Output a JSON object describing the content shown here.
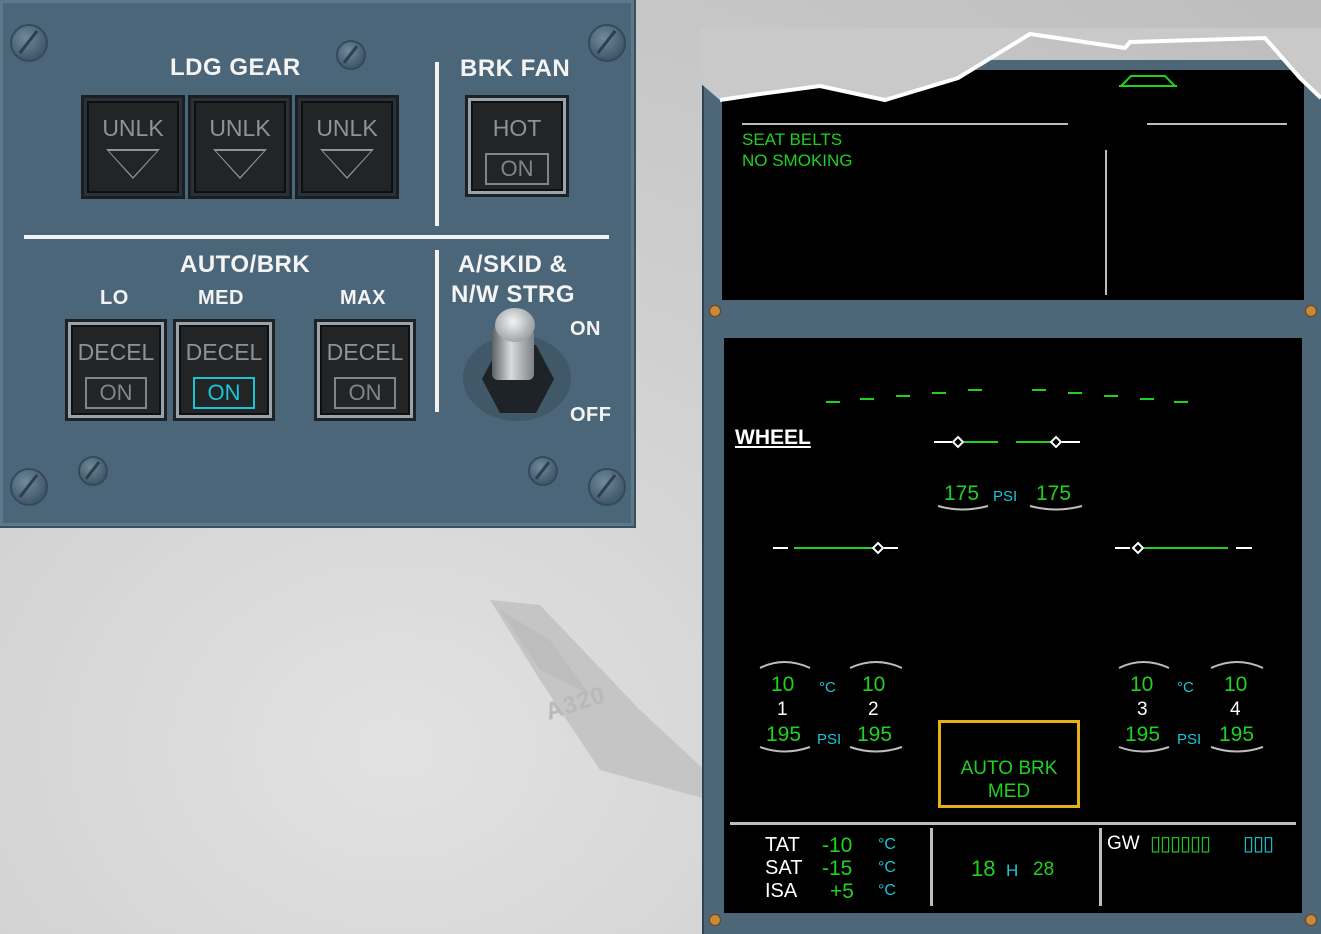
{
  "background": {
    "tail_marking": "A320"
  },
  "overhead_panel": {
    "ldg_gear": {
      "title": "LDG GEAR",
      "indicators": [
        {
          "label": "UNLK",
          "state": "unlit"
        },
        {
          "label": "UNLK",
          "state": "unlit"
        },
        {
          "label": "UNLK",
          "state": "unlit"
        }
      ]
    },
    "brk_fan": {
      "title": "BRK FAN",
      "top_label": "HOT",
      "on_label": "ON",
      "on_lit": false
    },
    "auto_brk": {
      "title": "AUTO/BRK",
      "buttons": [
        {
          "mode": "LO",
          "label": "DECEL",
          "on_label": "ON",
          "on_lit": false
        },
        {
          "mode": "MED",
          "label": "DECEL",
          "on_label": "ON",
          "on_lit": true
        },
        {
          "mode": "MAX",
          "label": "DECEL",
          "on_label": "ON",
          "on_lit": false
        }
      ]
    },
    "askid": {
      "title_line1": "A/SKID &",
      "title_line2": "N/W STRG",
      "on_label": "ON",
      "off_label": "OFF",
      "position": "ON"
    }
  },
  "ecam_upper": {
    "memo_line1": "SEAT BELTS",
    "memo_line2": "NO SMOKING"
  },
  "ecam_lower": {
    "page_title": "WHEEL",
    "nose": {
      "psi_left": "175",
      "psi_unit": "PSI",
      "psi_right": "175"
    },
    "wheels_left": {
      "temp_unit": "°C",
      "psi_unit": "PSI",
      "wheels": [
        {
          "number": "1",
          "temp": "10",
          "psi": "195"
        },
        {
          "number": "2",
          "temp": "10",
          "psi": "195"
        }
      ]
    },
    "wheels_right": {
      "temp_unit": "°C",
      "psi_unit": "PSI",
      "wheels": [
        {
          "number": "3",
          "temp": "10",
          "psi": "195"
        },
        {
          "number": "4",
          "temp": "10",
          "psi": "195"
        }
      ]
    },
    "autobrk": {
      "line1": "AUTO BRK",
      "line2": "MED"
    },
    "status": {
      "tat_label": "TAT",
      "tat_value": "-10",
      "tat_unit": "°C",
      "sat_label": "SAT",
      "sat_value": "-15",
      "sat_unit": "°C",
      "isa_label": "ISA",
      "isa_value": "+5",
      "isa_unit": "°C",
      "time_h": "18",
      "time_h_label": "H",
      "time_m": "28",
      "gw_label": "GW",
      "gw_value": "▯▯▯▯▯▯",
      "gw_unit": "▯▯▯"
    }
  },
  "colors": {
    "panel": "#4b6679",
    "ecam_green": "#1fd21f",
    "ecam_cyan": "#17c8d8",
    "autobrk_frame": "#e6b117"
  }
}
